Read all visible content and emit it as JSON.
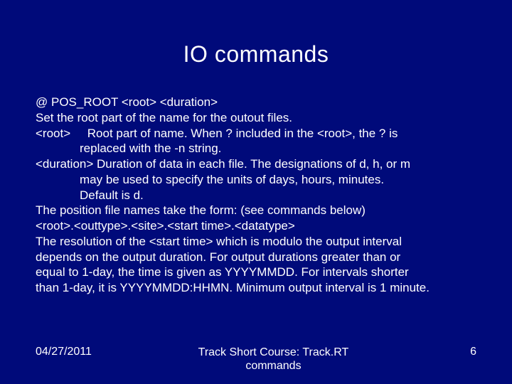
{
  "title": "IO commands",
  "lines": {
    "l0": "@ POS_ROOT <root> <duration>",
    "l1": "Set the root part of the name for the outout files.",
    "l2a": "<root>",
    "l2b": "Root part of name.  When ? included in the <root>, the ? is",
    "l3": "replaced with the -n string.",
    "l4": "<duration> Duration of data in each file.  The designations of d, h, or m",
    "l5": "may be used to specify the units of days, hours, minutes.",
    "l6": "Default is d.",
    "l7": "The position file names take the form: (see commands below)",
    "l8": "<root>.<outtype>.<site>.<start time>.<datatype>",
    "l9": "The resolution of the <start time> which is modulo the output interval",
    "l10": "depends on the output duration.  For output durations greater than or",
    "l11": "equal to 1-day, the time is given as YYYYMMDD.  For intervals shorter",
    "l12": "than 1-day, it is YYYYMMDD:HHMN.  Minimum output interval is 1 minute."
  },
  "footer": {
    "date": "04/27/2011",
    "center1": "Track Short Course: Track.RT",
    "center2": "commands",
    "page": "6"
  }
}
